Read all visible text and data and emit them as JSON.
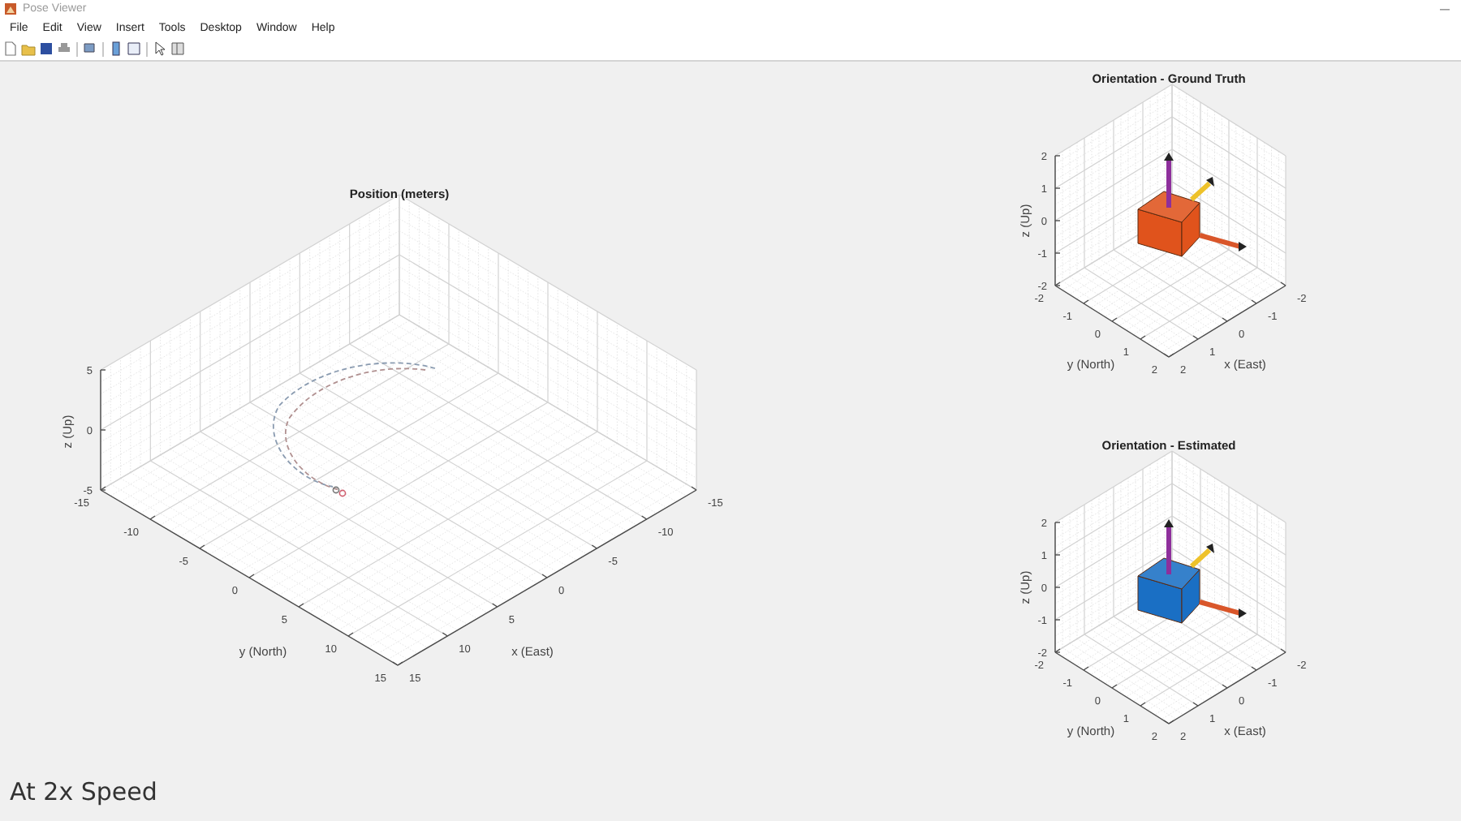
{
  "window": {
    "title": "Pose Viewer"
  },
  "menu": [
    "File",
    "Edit",
    "View",
    "Insert",
    "Tools",
    "Desktop",
    "Window",
    "Help"
  ],
  "plots": [
    {
      "kind": "position",
      "title": "Position (meters)",
      "x_label": "x (East)",
      "y_label": "y (North)",
      "z_label": "z (Up)",
      "x_ticks": [
        "-15",
        "-10",
        "-5",
        "0",
        "5",
        "10",
        "15"
      ],
      "y_ticks": [
        "-15",
        "-10",
        "-5",
        "0",
        "5",
        "10",
        "15"
      ],
      "z_ticks": [
        "5",
        "0",
        "-5"
      ]
    },
    {
      "kind": "orientation",
      "title": "Orientation - Ground Truth",
      "color": "#e0531c",
      "x_label": "x (East)",
      "y_label": "y (North)",
      "z_label": "z (Up)",
      "x_ticks": [
        "-2",
        "-1",
        "0",
        "1",
        "2"
      ],
      "y_ticks": [
        "-2",
        "-1",
        "0",
        "1",
        "2"
      ],
      "z_ticks": [
        "2",
        "1",
        "0",
        "-1",
        "-2"
      ]
    },
    {
      "kind": "orientation",
      "title": "Orientation - Estimated",
      "color": "#1a6fc4",
      "x_label": "x (East)",
      "y_label": "y (North)",
      "z_label": "z (Up)",
      "x_ticks": [
        "-2",
        "-1",
        "0",
        "1",
        "2"
      ],
      "y_ticks": [
        "-2",
        "-1",
        "0",
        "1",
        "2"
      ],
      "z_ticks": [
        "2",
        "1",
        "0",
        "-1",
        "-2"
      ]
    }
  ],
  "caption": "At 2x Speed"
}
